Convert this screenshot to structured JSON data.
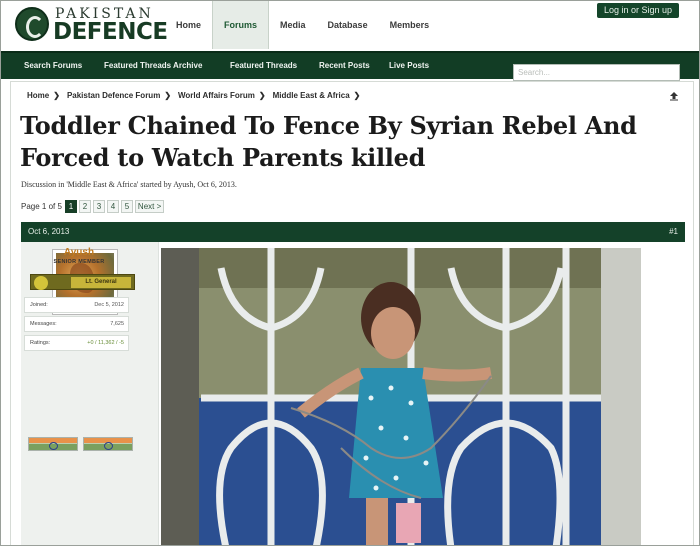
{
  "header": {
    "logo_top": "PAKISTAN",
    "logo_bottom": "DEFENCE",
    "nav": [
      {
        "label": "Home",
        "active": false
      },
      {
        "label": "Forums",
        "active": true
      },
      {
        "label": "Media",
        "active": false
      },
      {
        "label": "Database",
        "active": false
      },
      {
        "label": "Members",
        "active": false
      }
    ],
    "login_label": "Log in or Sign up"
  },
  "subnav": {
    "items": [
      {
        "label": "Search Forums"
      },
      {
        "label": "Featured Threads Archive"
      },
      {
        "label": "Featured Threads"
      },
      {
        "label": "Recent Posts"
      },
      {
        "label": "Live Posts"
      }
    ],
    "search_placeholder": "Search..."
  },
  "breadcrumb": [
    "Home",
    "Pakistan Defence Forum",
    "World Affairs Forum",
    "Middle East & Africa"
  ],
  "thread": {
    "title": "Toddler Chained To Fence By Syrian Rebel And Forced to Watch Parents killed",
    "meta": "Discussion in 'Middle East & Africa' started by Ayush, Oct 6, 2013.",
    "page_info": "Page 1 of 5",
    "pages": [
      "1",
      "2",
      "3",
      "4",
      "5"
    ],
    "current_page": "1",
    "next_label": "Next >"
  },
  "post": {
    "date": "Oct 6, 2013",
    "number": "#1",
    "user": {
      "name": "Ayush",
      "title": "SENIOR MEMBER",
      "rank": "Lt. General",
      "stats": [
        {
          "key": "Joined:",
          "value": "Dec 5, 2012"
        },
        {
          "key": "Messages:",
          "value": "7,625"
        },
        {
          "key": "Ratings:",
          "value": "+0 / 11,362 / -5"
        }
      ]
    }
  },
  "icons": {
    "breadcrumb_separator": "chevron-right-icon",
    "up": "up-arrow-icon",
    "logo": "crescent-emblem-icon",
    "rank_star": "star-icon",
    "flag": "india-flag-icon"
  }
}
